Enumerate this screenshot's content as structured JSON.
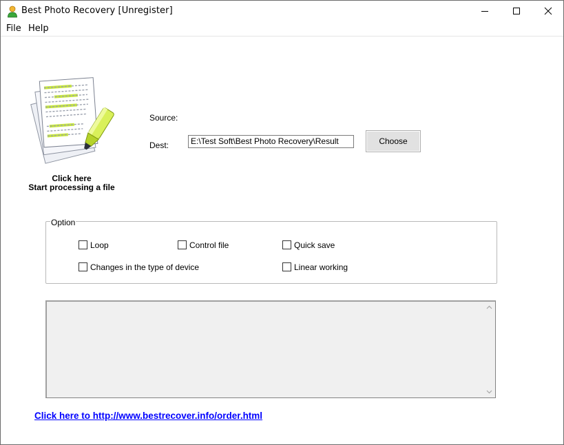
{
  "window": {
    "title": "Best Photo Recovery [Unregister]",
    "controls": [
      "minimize-icon",
      "maximize-icon",
      "close-icon"
    ]
  },
  "menu": {
    "file": "File",
    "help": "Help"
  },
  "action": {
    "line1": "Click here",
    "line2": "Start processing a file"
  },
  "source": {
    "label": "Source:",
    "value": ""
  },
  "dest": {
    "label": "Dest:",
    "value": "E:\\Test Soft\\Best Photo Recovery\\Result"
  },
  "choose_button": "Choose",
  "options": {
    "title": "Option",
    "loop": "Loop",
    "control_file": "Control file",
    "quick_save": "Quick save",
    "changes_device": "Changes in the type of device",
    "linear_working": "Linear working"
  },
  "order_link": "Click here to http://www.bestrecover.info/order.html",
  "colors": {
    "link": "#0000ff",
    "highlight": "#c8e83a"
  }
}
